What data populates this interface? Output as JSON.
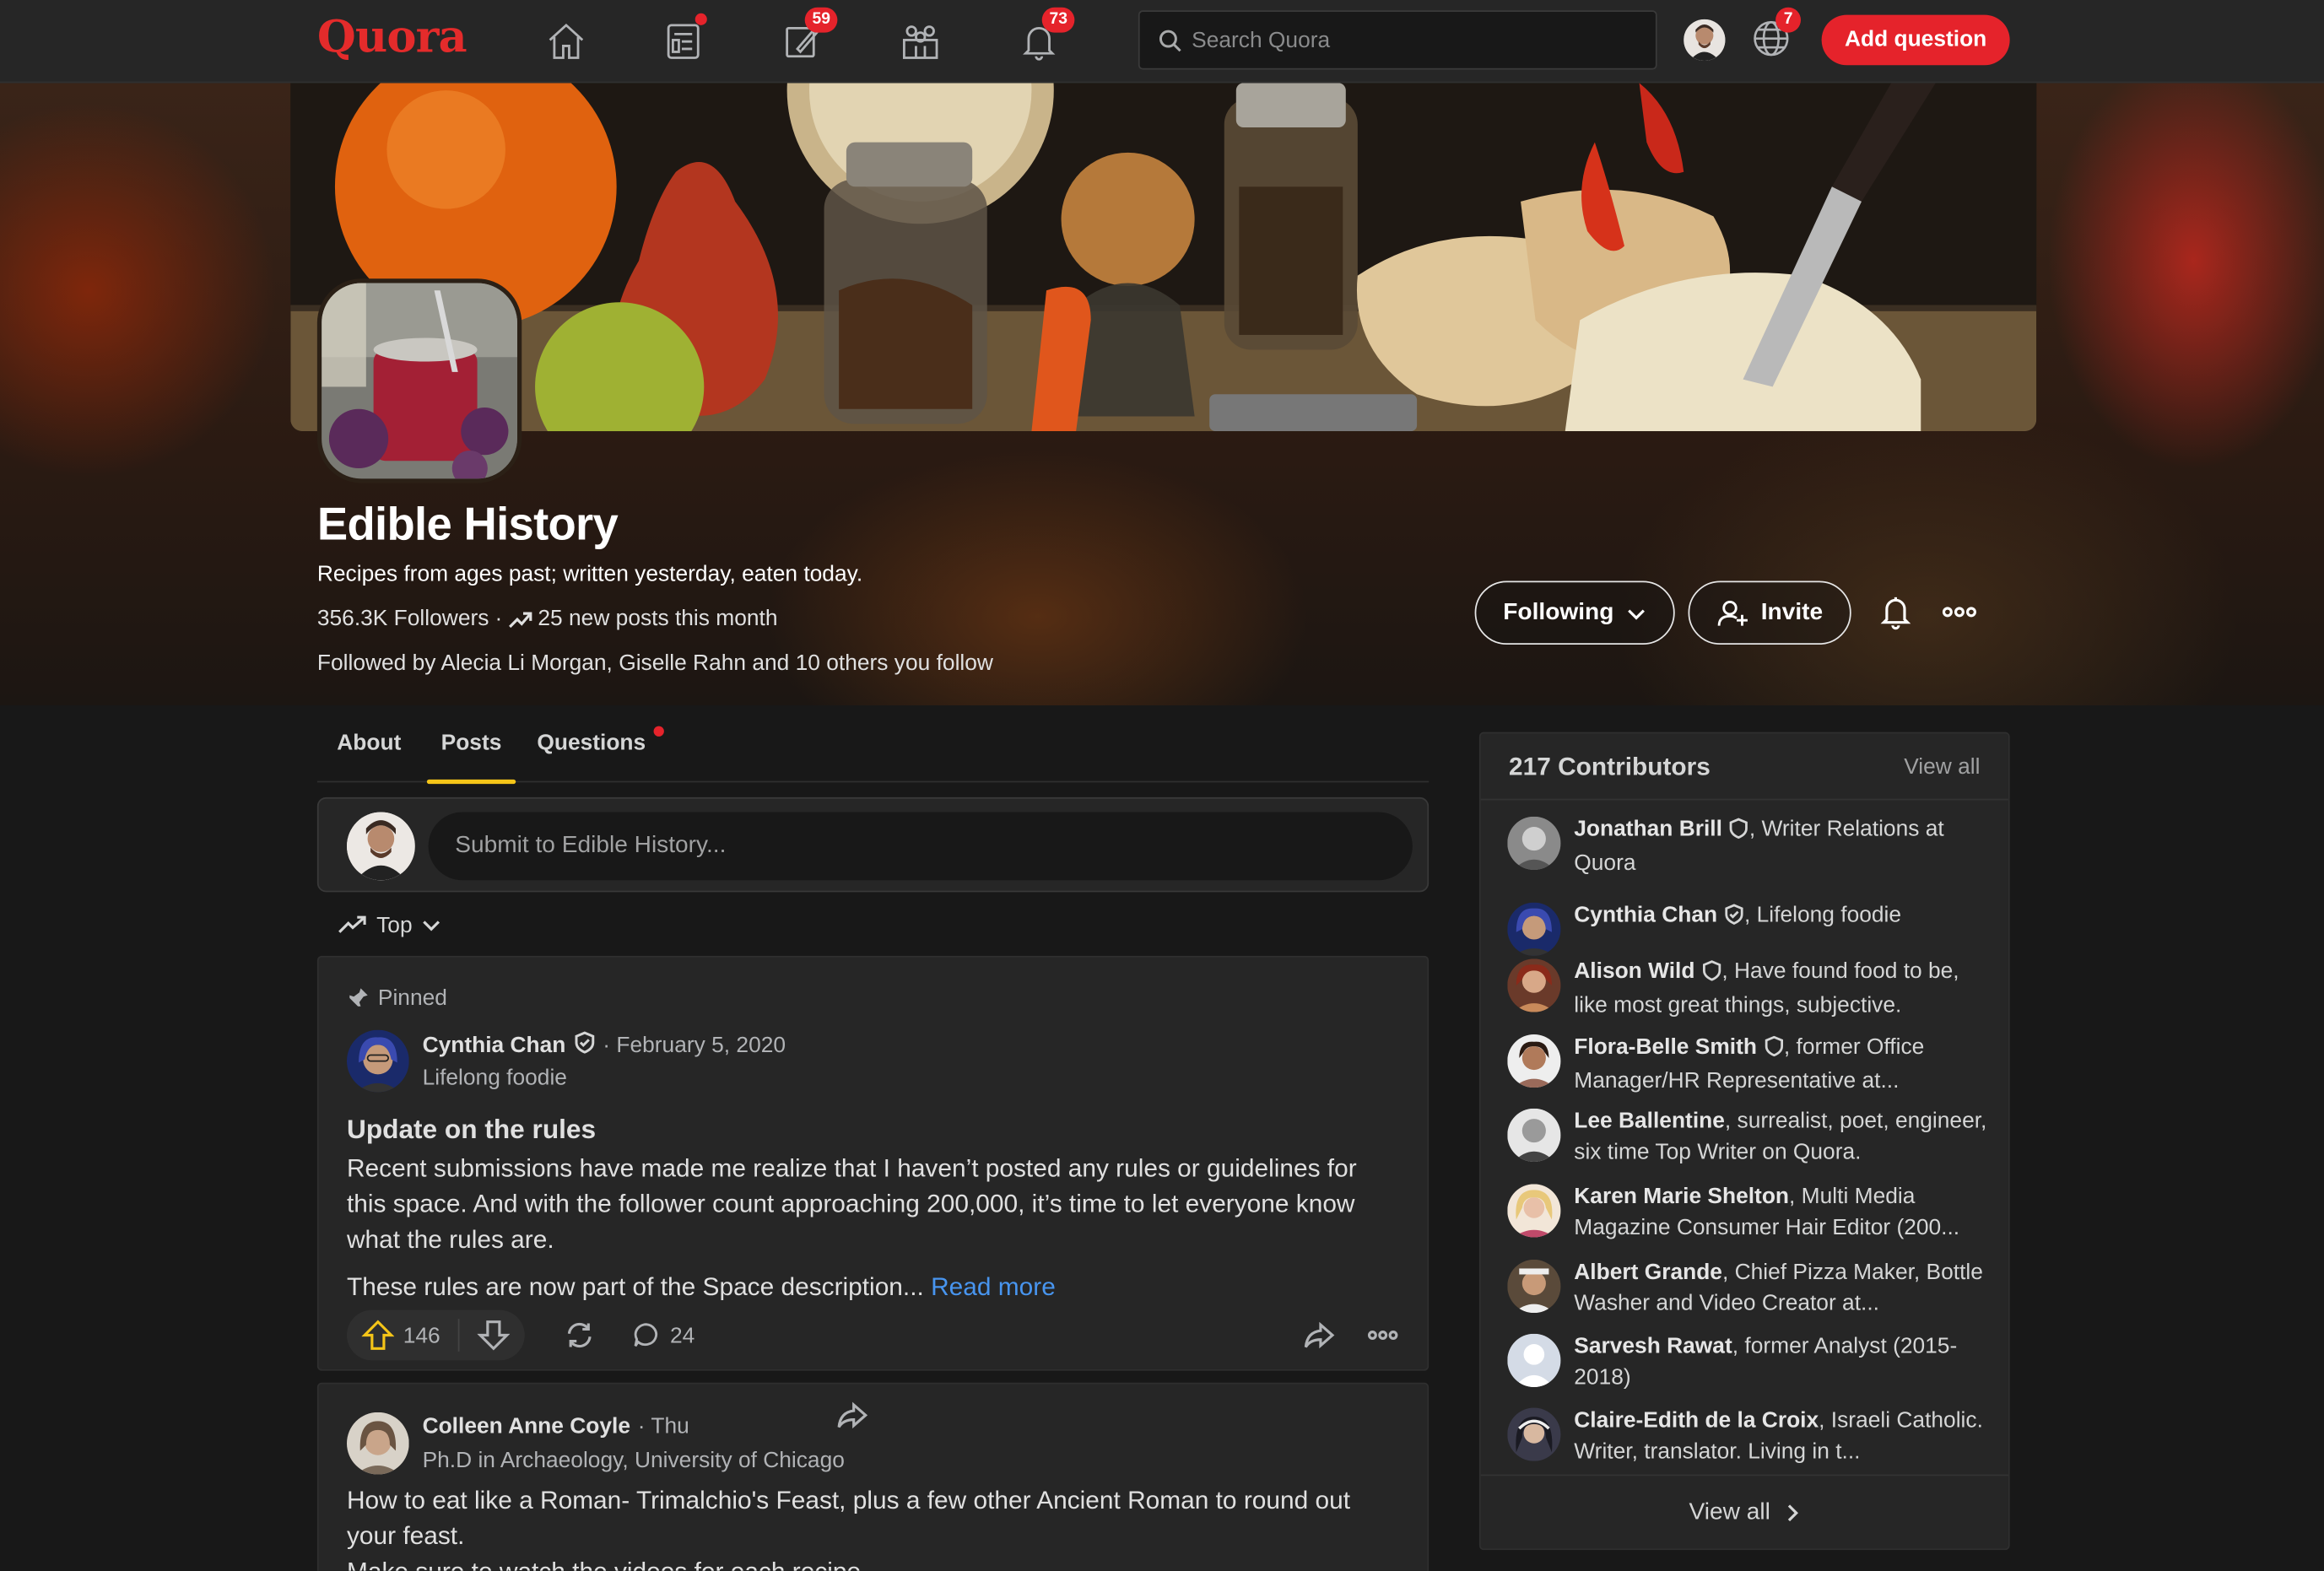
{
  "nav": {
    "logo": "Quora",
    "answer_badge": "59",
    "notif_badge": "73",
    "language_badge": "7",
    "search_placeholder": "Search Quora",
    "add_question": "Add question"
  },
  "space": {
    "title": "Edible History",
    "description": "Recipes from ages past; written yesterday, eaten today.",
    "followers": "356.3K Followers",
    "separator": "·",
    "new_posts": "25 new posts this month",
    "followed_prefix": "Followed by ",
    "followed_names": "Alecia Li Morgan, Giselle Rahn",
    "followed_suffix": " and 10 others you follow",
    "following_label": "Following",
    "invite_label": "Invite"
  },
  "tabs": {
    "about": "About",
    "posts": "Posts",
    "questions": "Questions"
  },
  "submit": {
    "placeholder": "Submit to Edible History..."
  },
  "sort": {
    "label": "Top"
  },
  "posts": [
    {
      "pinned_label": "Pinned",
      "author": "Cynthia Chan",
      "date": "· February 5, 2020",
      "credential": "Lifelong foodie",
      "title": "Update on the rules",
      "body": "Recent submissions have made me realize that I haven’t posted any rules or guidelines for this space. And with the follower count approaching 200,000, it’s time to let everyone know what the rules are.",
      "body2": "These rules are now part of the Space description...",
      "read_more": "Read more",
      "upvotes": "146",
      "comments": "24"
    },
    {
      "author": "Colleen Anne Coyle",
      "date": "· Thu",
      "credential": "Ph.D in Archaeology, University of Chicago",
      "body": "How to eat like a Roman- Trimalchio's Feast, plus a few other Ancient Roman to round out your feast.",
      "body2": "Make sure to watch the videos for each recipe"
    }
  ],
  "contributors": {
    "title": "217 Contributors",
    "view_all": "View all",
    "footer": "View all",
    "items": [
      {
        "name": "Jonathan Brill",
        "desc": ", Writer Relations at Quora"
      },
      {
        "name": "Cynthia Chan",
        "desc": ", Lifelong foodie"
      },
      {
        "name": "Alison Wild",
        "desc": ", Have found food to be, like most great things, subjective."
      },
      {
        "name": "Flora-Belle Smith",
        "desc": ", former Office Manager/HR Representative at..."
      },
      {
        "name": "Lee Ballentine",
        "desc": ", surrealist, poet, engineer, six time Top Writer on Quora."
      },
      {
        "name": "Karen Marie Shelton",
        "desc": ", Multi Media Magazine Consumer Hair Editor (200..."
      },
      {
        "name": "Albert Grande",
        "desc": ", Chief Pizza Maker, Bottle Washer and Video Creator at..."
      },
      {
        "name": "Sarvesh Rawat",
        "desc": ", former Analyst (2015-2018)"
      },
      {
        "name": "Claire-Edith de la Croix",
        "desc": ", Israeli Catholic. Writer, translator. Living in t..."
      }
    ]
  },
  "colors": {
    "brand": "#e42b2b",
    "accent_tab": "#f5c518",
    "link": "#4895ef",
    "upvote": "#f5c518"
  }
}
